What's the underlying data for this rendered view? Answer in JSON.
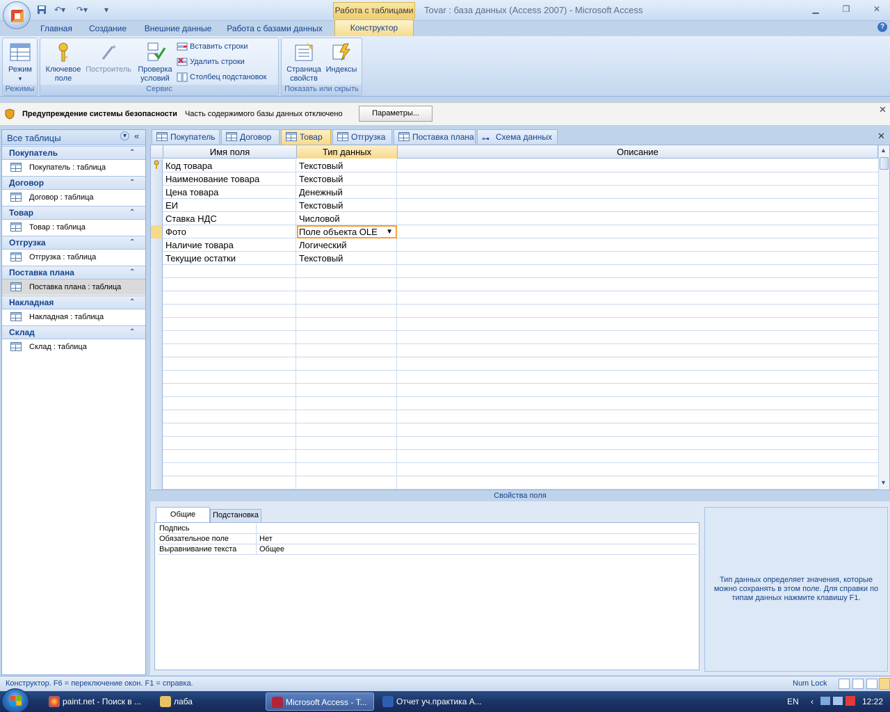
{
  "window": {
    "title": "Tovar : база данных (Access 2007) - Microsoft Access",
    "context_tab": "Работа с таблицами"
  },
  "ribbon": {
    "tabs": [
      "Главная",
      "Создание",
      "Внешние данные",
      "Работа с базами данных",
      "Конструктор"
    ],
    "active_tab": "Конструктор",
    "groups": {
      "modes": {
        "label": "Режимы",
        "view_button": "Режим"
      },
      "tools": {
        "label": "Сервис",
        "primary_key": "Ключевое поле",
        "builder": "Построитель",
        "test_rules": "Проверка условий",
        "insert_rows": "Вставить строки",
        "delete_rows": "Удалить строки",
        "lookup_column": "Столбец  подстановок"
      },
      "show_hide": {
        "label": "Показать или скрыть",
        "property_sheet": "Страница свойств",
        "indexes": "Индексы"
      }
    }
  },
  "security_bar": {
    "title": "Предупреждение системы безопасности",
    "message": "Часть содержимого базы данных отключено",
    "button": "Параметры..."
  },
  "nav_pane": {
    "header": "Все таблицы",
    "groups": [
      {
        "name": "Покупатель",
        "item": "Покупатель : таблица"
      },
      {
        "name": "Договор",
        "item": "Договор : таблица"
      },
      {
        "name": "Товар",
        "item": "Товар : таблица"
      },
      {
        "name": "Отгрузка",
        "item": "Отгрузка : таблица"
      },
      {
        "name": "Поставка плана",
        "item": "Поставка плана : таблица"
      },
      {
        "name": "Накладная",
        "item": "Накладная : таблица"
      },
      {
        "name": "Склад",
        "item": "Склад : таблица"
      }
    ]
  },
  "doc_tabs": [
    "Покупатель",
    "Договор",
    "Товар",
    "Отгрузка",
    "Поставка плана",
    "Схема данных"
  ],
  "active_doc_tab": "Товар",
  "design_grid": {
    "headers": {
      "field": "Имя поля",
      "type": "Тип данных",
      "description": "Описание"
    },
    "rows": [
      {
        "field": "Код товара",
        "type": "Текстовый",
        "key": true
      },
      {
        "field": "Наименование товара",
        "type": "Текстовый"
      },
      {
        "field": "Цена товара",
        "type": "Денежный"
      },
      {
        "field": "ЕИ",
        "type": "Текстовый"
      },
      {
        "field": "Ставка НДС",
        "type": "Числовой"
      },
      {
        "field": "Фото",
        "type": "Поле объекта OLE",
        "current": true
      },
      {
        "field": "Наличие товара",
        "type": "Логический"
      },
      {
        "field": "Текущие остатки",
        "type": "Текстовый"
      }
    ]
  },
  "field_properties": {
    "title": "Свойства поля",
    "tabs": [
      "Общие",
      "Подстановка"
    ],
    "rows": [
      {
        "name": "Подпись",
        "value": ""
      },
      {
        "name": "Обязательное поле",
        "value": "Нет"
      },
      {
        "name": "Выравнивание текста",
        "value": "Общее"
      }
    ],
    "hint": "Тип данных определяет значения, которые можно сохранять в этом поле.  Для справки по типам данных нажмите клавишу F1."
  },
  "status_bar": {
    "left": "Конструктор.  F6 = переключение окон.  F1 = справка.",
    "numlock": "Num Lock"
  },
  "taskbar": {
    "items": [
      "paint.net - Поиск в ...",
      "лаба",
      "Microsoft Access - Т...",
      "Отчет уч.практика А..."
    ],
    "lang": "EN",
    "time": "12:22"
  },
  "colors": {
    "accent": "#15428b",
    "active_tab": "#f7d98b",
    "ribbon_bg": "#dde9f8"
  }
}
